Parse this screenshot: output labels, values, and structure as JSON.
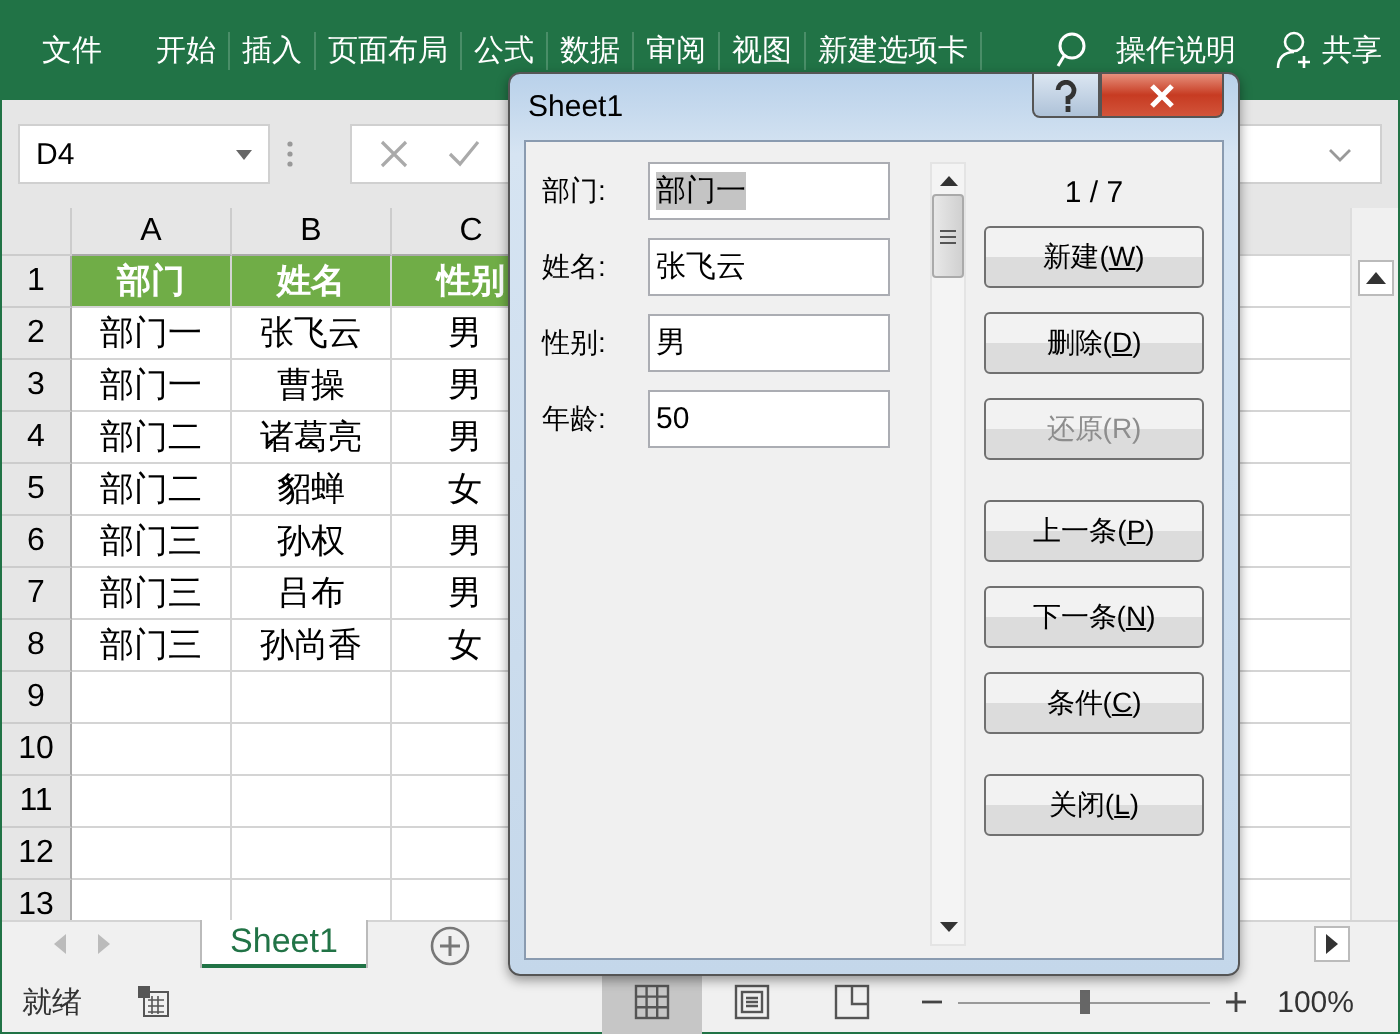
{
  "ribbon_tabs": [
    {
      "label": "文件",
      "selected": false
    },
    {
      "label": "开始",
      "selected": false
    },
    {
      "label": "插入",
      "selected": false
    },
    {
      "label": "页面布局",
      "selected": false
    },
    {
      "label": "公式",
      "selected": false
    },
    {
      "label": "数据",
      "selected": false
    },
    {
      "label": "审阅",
      "selected": false
    },
    {
      "label": "视图",
      "selected": false
    },
    {
      "label": "新建选项卡",
      "selected": false
    }
  ],
  "tell_me": {
    "label": "操作说明"
  },
  "share": {
    "label": "共享"
  },
  "name_box": {
    "value": "D4"
  },
  "columns": [
    "A",
    "B",
    "C"
  ],
  "rows": [
    {
      "number": "1",
      "cells": [
        "部门",
        "姓名",
        "性别"
      ],
      "kind": "header"
    },
    {
      "number": "2",
      "cells": [
        "部门一",
        "张飞云",
        "男"
      ],
      "kind": "data"
    },
    {
      "number": "3",
      "cells": [
        "部门一",
        "曹操",
        "男"
      ],
      "kind": "data"
    },
    {
      "number": "4",
      "cells": [
        "部门二",
        "诸葛亮",
        "男"
      ],
      "kind": "data"
    },
    {
      "number": "5",
      "cells": [
        "部门二",
        "貂蝉",
        "女"
      ],
      "kind": "data"
    },
    {
      "number": "6",
      "cells": [
        "部门三",
        "孙权",
        "男"
      ],
      "kind": "data"
    },
    {
      "number": "7",
      "cells": [
        "部门三",
        "吕布",
        "男"
      ],
      "kind": "data"
    },
    {
      "number": "8",
      "cells": [
        "部门三",
        "孙尚香",
        "女"
      ],
      "kind": "data"
    },
    {
      "number": "9",
      "cells": [],
      "kind": "data"
    },
    {
      "number": "10",
      "cells": [],
      "kind": "data"
    },
    {
      "number": "11",
      "cells": [],
      "kind": "data"
    },
    {
      "number": "12",
      "cells": [],
      "kind": "data"
    },
    {
      "number": "13",
      "cells": [],
      "kind": "data"
    }
  ],
  "sheet_tabs": [
    {
      "label": "Sheet1",
      "selected": true
    }
  ],
  "dialog": {
    "title": "Sheet1",
    "counter": "1 / 7",
    "fields": [
      {
        "label": "部门:",
        "value": "部门一",
        "selected": true
      },
      {
        "label": "姓名:",
        "value": "张飞云",
        "selected": false
      },
      {
        "label": "性别:",
        "value": "男",
        "selected": false
      },
      {
        "label": "年龄:",
        "value": "50",
        "selected": false
      }
    ],
    "button_groups": [
      [
        {
          "before": "新建(",
          "key": "W",
          "after": ")",
          "disabled": false
        },
        {
          "before": "删除(",
          "key": "D",
          "after": ")",
          "disabled": false
        },
        {
          "before": "还原(R)",
          "disabled": true
        }
      ],
      [
        {
          "before": "上一条(",
          "key": "P",
          "after": ")",
          "disabled": false
        },
        {
          "before": "下一条(",
          "key": "N",
          "after": ")",
          "disabled": false
        },
        {
          "before": "条件(",
          "key": "C",
          "after": ")",
          "disabled": false
        }
      ],
      [
        {
          "before": "关闭(",
          "key": "L",
          "after": ")",
          "disabled": false
        }
      ]
    ]
  },
  "status_bar": {
    "text": "就绪",
    "views": [
      {
        "kind": "normal",
        "selected": true
      },
      {
        "kind": "page",
        "selected": false
      },
      {
        "kind": "break",
        "selected": false
      }
    ],
    "zoom": {
      "level": 0.5,
      "reading": "100%"
    }
  }
}
